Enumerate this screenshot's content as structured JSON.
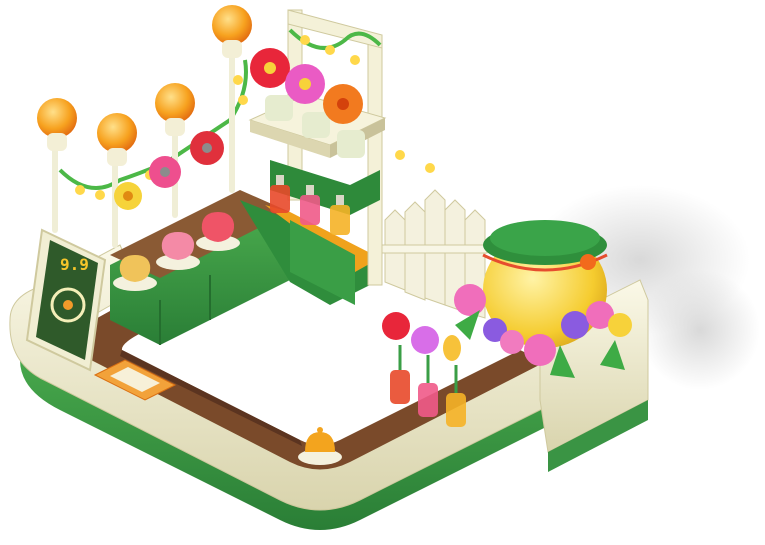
{
  "sign": {
    "price": "9.9"
  },
  "colors": {
    "counter_cream": "#f1eed3",
    "counter_green": "#3f9a46",
    "floor_brown": "#7a4a2a",
    "lamp_orange": "#f39a1c",
    "jar_yellow": "#f7cf3a",
    "jar_lid_green": "#2f8f3c",
    "board_green": "#2f5a2a"
  },
  "icons": {
    "lamp": "balloon-lamp-icon",
    "flower": "flower-icon",
    "jar": "honey-jar-icon",
    "bottle": "perfume-bottle-icon",
    "bell": "service-bell-icon",
    "vase": "vase-icon",
    "fence": "picket-fence-icon",
    "board": "price-board-icon"
  }
}
